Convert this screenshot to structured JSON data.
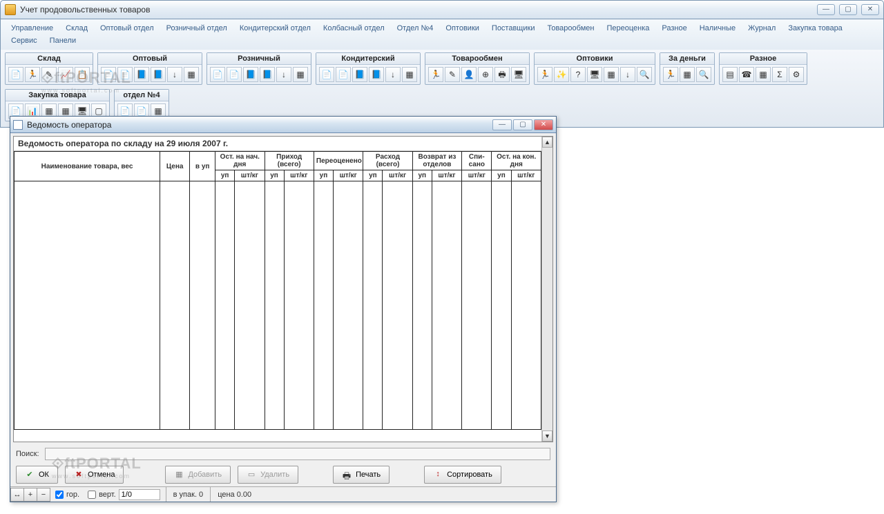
{
  "app": {
    "title": "Учет продовольственных товаров"
  },
  "menu": [
    "Управление",
    "Склад",
    "Оптовый отдел",
    "Розничный отдел",
    "Кондитерский отдел",
    "Колбасный отдел",
    "Отдел №4",
    "Оптовики",
    "Поставщики",
    "Товарообмен",
    "Переоценка",
    "Разное",
    "Наличные",
    "Журнал",
    "Закупка товара",
    "Сервис",
    "Панели"
  ],
  "toolbar_groups": [
    {
      "title": "Склад",
      "icons": [
        "📄",
        "🏃",
        "✎",
        "📈",
        "📋"
      ]
    },
    {
      "title": "Оптовый",
      "icons": [
        "📄",
        "📄",
        "📘",
        "📘",
        "↓",
        "▦"
      ]
    },
    {
      "title": "Розничный",
      "icons": [
        "📄",
        "📄",
        "📘",
        "📘",
        "↓",
        "▦"
      ]
    },
    {
      "title": "Кондитерский",
      "icons": [
        "📄",
        "📄",
        "📘",
        "📘",
        "↓",
        "▦"
      ]
    },
    {
      "title": "Товарообмен",
      "icons": [
        "🏃",
        "✎",
        "👤",
        "⊕",
        "🖶",
        "🖥"
      ]
    },
    {
      "title": "Оптовики",
      "icons": [
        "🏃",
        "✨",
        "?",
        "🖥",
        "▦",
        "↓",
        "🔍"
      ]
    },
    {
      "title": "За деньги",
      "icons": [
        "🏃",
        "▦",
        "🔍"
      ]
    },
    {
      "title": "Разное",
      "icons": [
        "▤",
        "☎",
        "▦",
        "Σ",
        "⚙"
      ]
    },
    {
      "title": "Закупка товара",
      "icons": [
        "📄",
        "📊",
        "▦",
        "▦",
        "🖥",
        "▢"
      ]
    },
    {
      "title": "отдел №4",
      "icons": [
        "📄",
        "📄",
        "▦"
      ]
    }
  ],
  "modal": {
    "title": "Ведомость оператора",
    "report_title": "Ведомость оператора по складу на  29 июля 2007 г.",
    "columns": {
      "name": "Наименование товара, вес",
      "price": "Цена",
      "in_pack": "в уп",
      "groups": [
        {
          "title": "Ост. на нач. дня",
          "sub": [
            "уп",
            "шт/кг"
          ]
        },
        {
          "title": "Приход (всего)",
          "sub": [
            "уп",
            "шт/кг"
          ]
        },
        {
          "title": "Переоценено",
          "sub": [
            "уп",
            "шт/кг"
          ]
        },
        {
          "title": "Расход (всего)",
          "sub": [
            "уп",
            "шт/кг"
          ]
        },
        {
          "title": "Возврат из отделов",
          "sub": [
            "уп",
            "шт/кг"
          ]
        },
        {
          "title": "Спи-\nсано",
          "sub": [
            "шт/кг"
          ]
        },
        {
          "title": "Ост. на кон. дня",
          "sub": [
            "уп",
            "шт/кг"
          ]
        }
      ]
    },
    "search_label": "Поиск:",
    "buttons": {
      "ok": "ОК",
      "cancel": "Отмена",
      "add": "Добавить",
      "delete": "Удалить",
      "print": "Печать",
      "sort": "Сортировать"
    },
    "status": {
      "hor": "гор.",
      "vert": "верт.",
      "counter": "1/0",
      "pack": "в упак. 0",
      "price": "цена 0.00"
    }
  },
  "watermark": {
    "main": "⟐ftPORTAL",
    "sub": "www.softportal.com"
  }
}
